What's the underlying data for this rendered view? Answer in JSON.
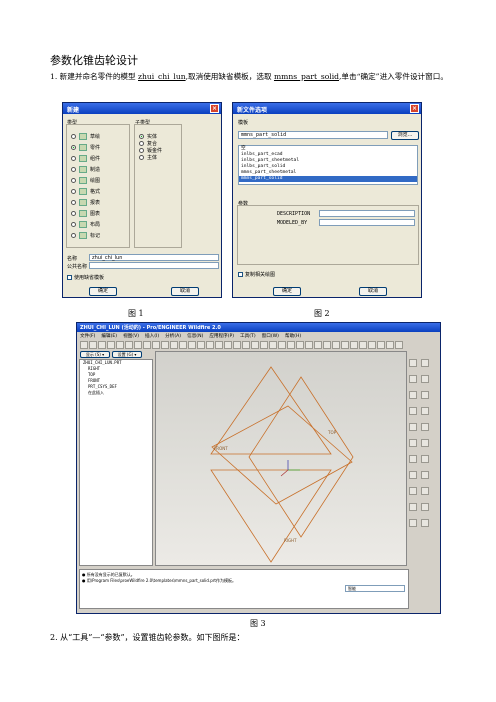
{
  "doc": {
    "title": "参数化锥齿轮设计",
    "step1_prefix": "1. 新建并命名零件的模型 ",
    "step1_model": "zhui_chi_lun",
    "step1_mid": ",取消使用缺省模板，选取 ",
    "step1_template": "mmns_part_solid",
    "step1_suffix": ",单击“确定”进入零件设计窗口。",
    "fig1": "图 1",
    "fig2": "图 2",
    "fig3": "图 3",
    "step2": "2. 从“工具”—“参数”，设置锥齿轮参数。如下图所是："
  },
  "new_dialog": {
    "title": "新建",
    "type_label": "类型",
    "subtype_label": "子类型",
    "types": [
      "草绘",
      "零件",
      "组件",
      "制造",
      "绘图",
      "格式",
      "报表",
      "图表",
      "布局",
      "标记"
    ],
    "subtypes": [
      "实体",
      "复合",
      "钣金件",
      "主体"
    ],
    "name_label": "名称",
    "name_value": "zhui_chi_lun",
    "common_name_label": "公共名称",
    "use_default_label": "使用缺省模板",
    "ok": "确定",
    "cancel": "取消"
  },
  "template_dialog": {
    "title": "新文件选项",
    "template_label": "模板",
    "template_value": "mmns_part_solid",
    "browse": "浏览...",
    "items": [
      "空",
      "inlbs_part_ecad",
      "inlbs_part_sheetmetal",
      "inlbs_part_solid",
      "mmns_part_sheetmetal",
      "mmns_part_solid"
    ],
    "params_label": "参数",
    "param1": "DESCRIPTION",
    "param2": "MODELED_BY",
    "copy_label": "复制相关绘图",
    "ok": "确定",
    "cancel": "取消"
  },
  "app": {
    "title": "ZHUI_CHI_LUN (活动的) - Pro/ENGINEER Wildfire 2.0",
    "menus": [
      "文件(F)",
      "编辑(E)",
      "视图(V)",
      "插入(I)",
      "分析(A)",
      "信息(N)",
      "应用程序(P)",
      "工具(T)",
      "窗口(W)",
      "帮助(H)"
    ],
    "show_btn": "显示 (S) ▾",
    "settings_btn": "设置 (G) ▾",
    "tree": [
      "ZHUI_CHI_LUN.PRT",
      "RIGHT",
      "TOP",
      "FRONT",
      "PRT_CSYS_DEF",
      "在此插入"
    ],
    "datum_labels": [
      "FRONT",
      "TOP",
      "RIGHT"
    ],
    "msg": [
      "● 所有没有显示的已复默认。",
      "● 用\\Program Files\\proeWildfire 2.0\\templates\\mmns_part_solid.prt作为模板。"
    ],
    "filter": "智能"
  },
  "colors": {
    "datum": "#c8702a",
    "titlebar": "#0a3fbf",
    "dialog_bg": "#ece9d8"
  }
}
